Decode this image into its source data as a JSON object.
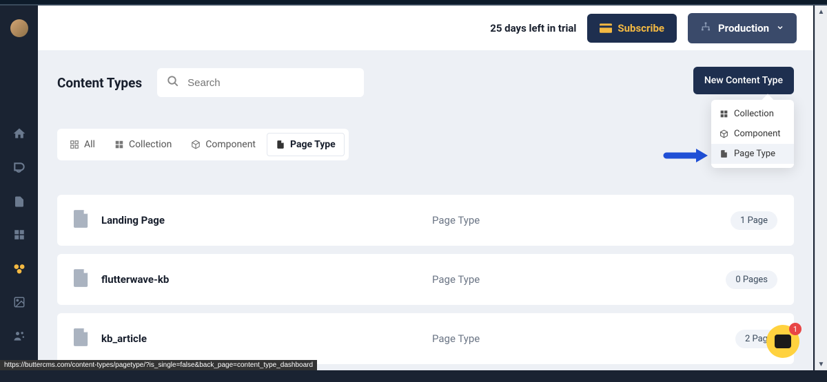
{
  "header": {
    "trial_text": "25 days left in trial",
    "subscribe_label": "Subscribe",
    "env_label": "Production"
  },
  "page_title": "Content Types",
  "search": {
    "placeholder": "Search"
  },
  "new_button_label": "New Content Type",
  "dropdown": {
    "items": [
      {
        "label": "Collection"
      },
      {
        "label": "Component"
      },
      {
        "label": "Page Type"
      }
    ]
  },
  "filters": {
    "all": "All",
    "collection": "Collection",
    "component": "Component",
    "page_type": "Page Type"
  },
  "rows": [
    {
      "name": "Landing Page",
      "type": "Page Type",
      "count": "1 Page"
    },
    {
      "name": "flutterwave-kb",
      "type": "Page Type",
      "count": "0 Pages"
    },
    {
      "name": "kb_article",
      "type": "Page Type",
      "count": "2 Pag"
    }
  ],
  "chat_badge": "1",
  "status_url": "https://buttercms.com/content-types/pagetype/?is_single=false&back_page=content_type_dashboard"
}
